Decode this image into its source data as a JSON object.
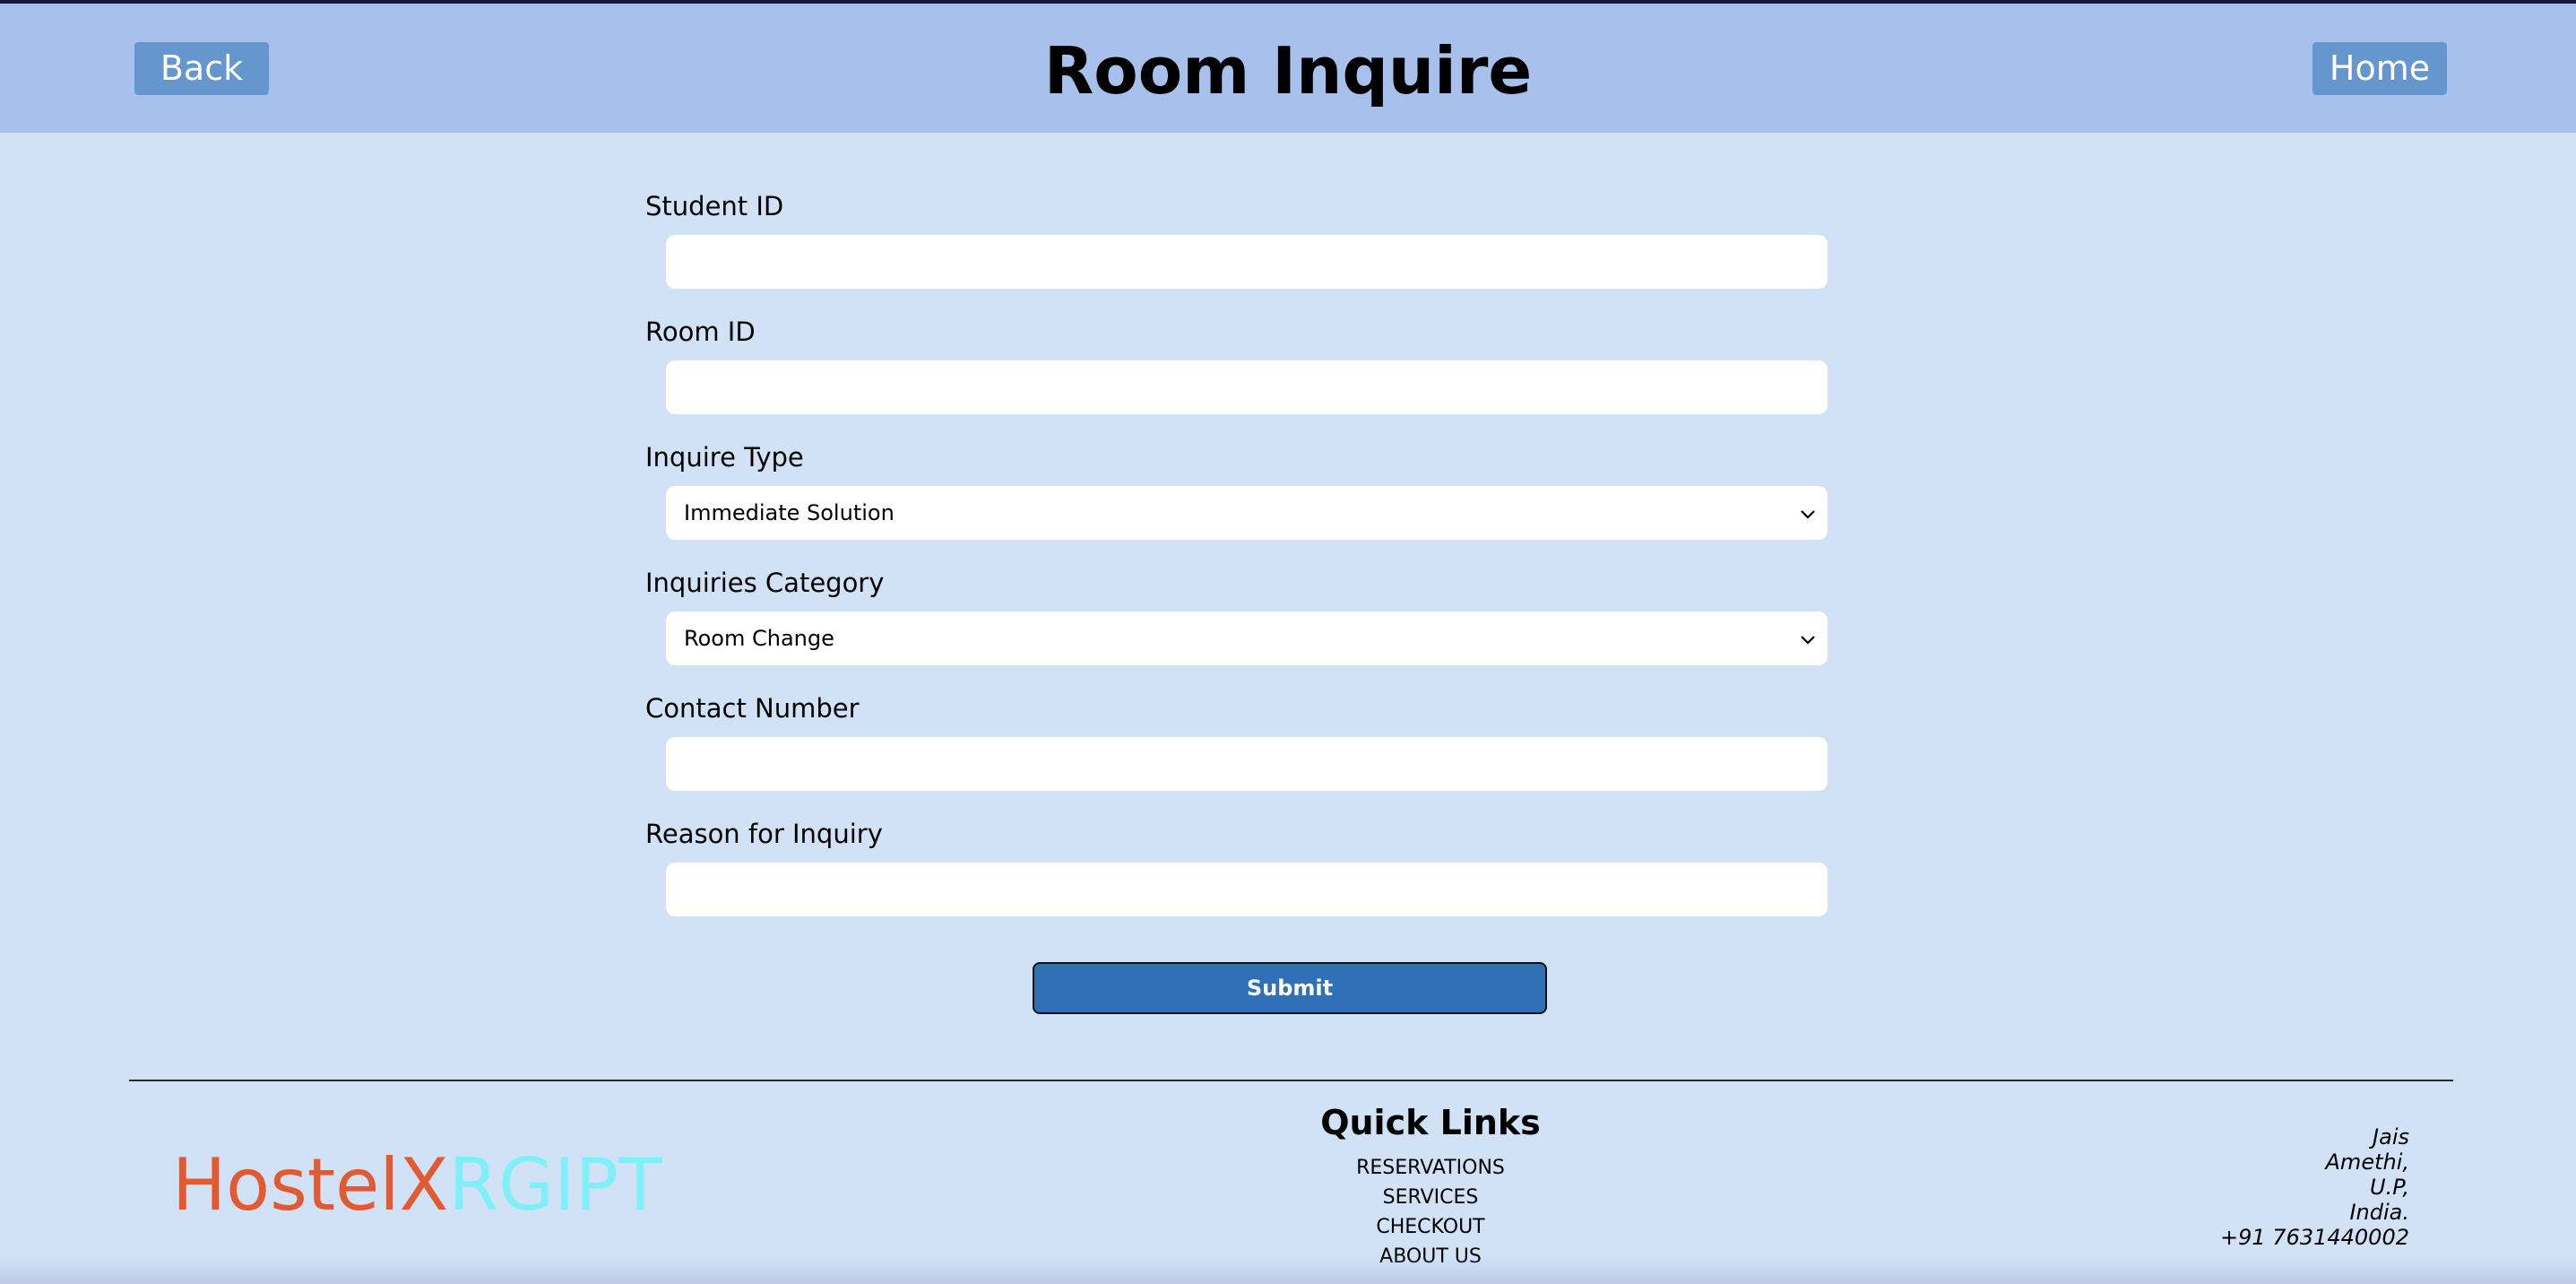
{
  "header": {
    "title": "Room Inquire",
    "back_label": "Back",
    "home_label": "Home"
  },
  "form": {
    "student_id": {
      "label": "Student ID",
      "value": ""
    },
    "room_id": {
      "label": "Room ID",
      "value": ""
    },
    "inquire_type": {
      "label": "Inquire Type",
      "selected": "Immediate Solution"
    },
    "inquiries_category": {
      "label": "Inquiries Category",
      "selected": "Room Change"
    },
    "contact_number": {
      "label": "Contact Number",
      "value": ""
    },
    "reason": {
      "label": "Reason for Inquiry",
      "value": ""
    },
    "submit_label": "Submit"
  },
  "footer": {
    "logo_part1": "HostelX",
    "logo_part2": "RGIPT",
    "quick_links_title": "Quick Links",
    "links": [
      "RESERVATIONS",
      "SERVICES",
      "CHECKOUT",
      "ABOUT US"
    ],
    "address": [
      "Jais",
      "Amethi,",
      "U.P,",
      "India.",
      "+91 7631440002"
    ]
  },
  "colors": {
    "header_bg": "#a8c0ec",
    "page_bg": "#d1e2f6",
    "button_bg": "#6596cd",
    "submit_bg": "#3070b6",
    "logo_orange": "#e25a31",
    "logo_cyan": "#7ff0f8"
  }
}
